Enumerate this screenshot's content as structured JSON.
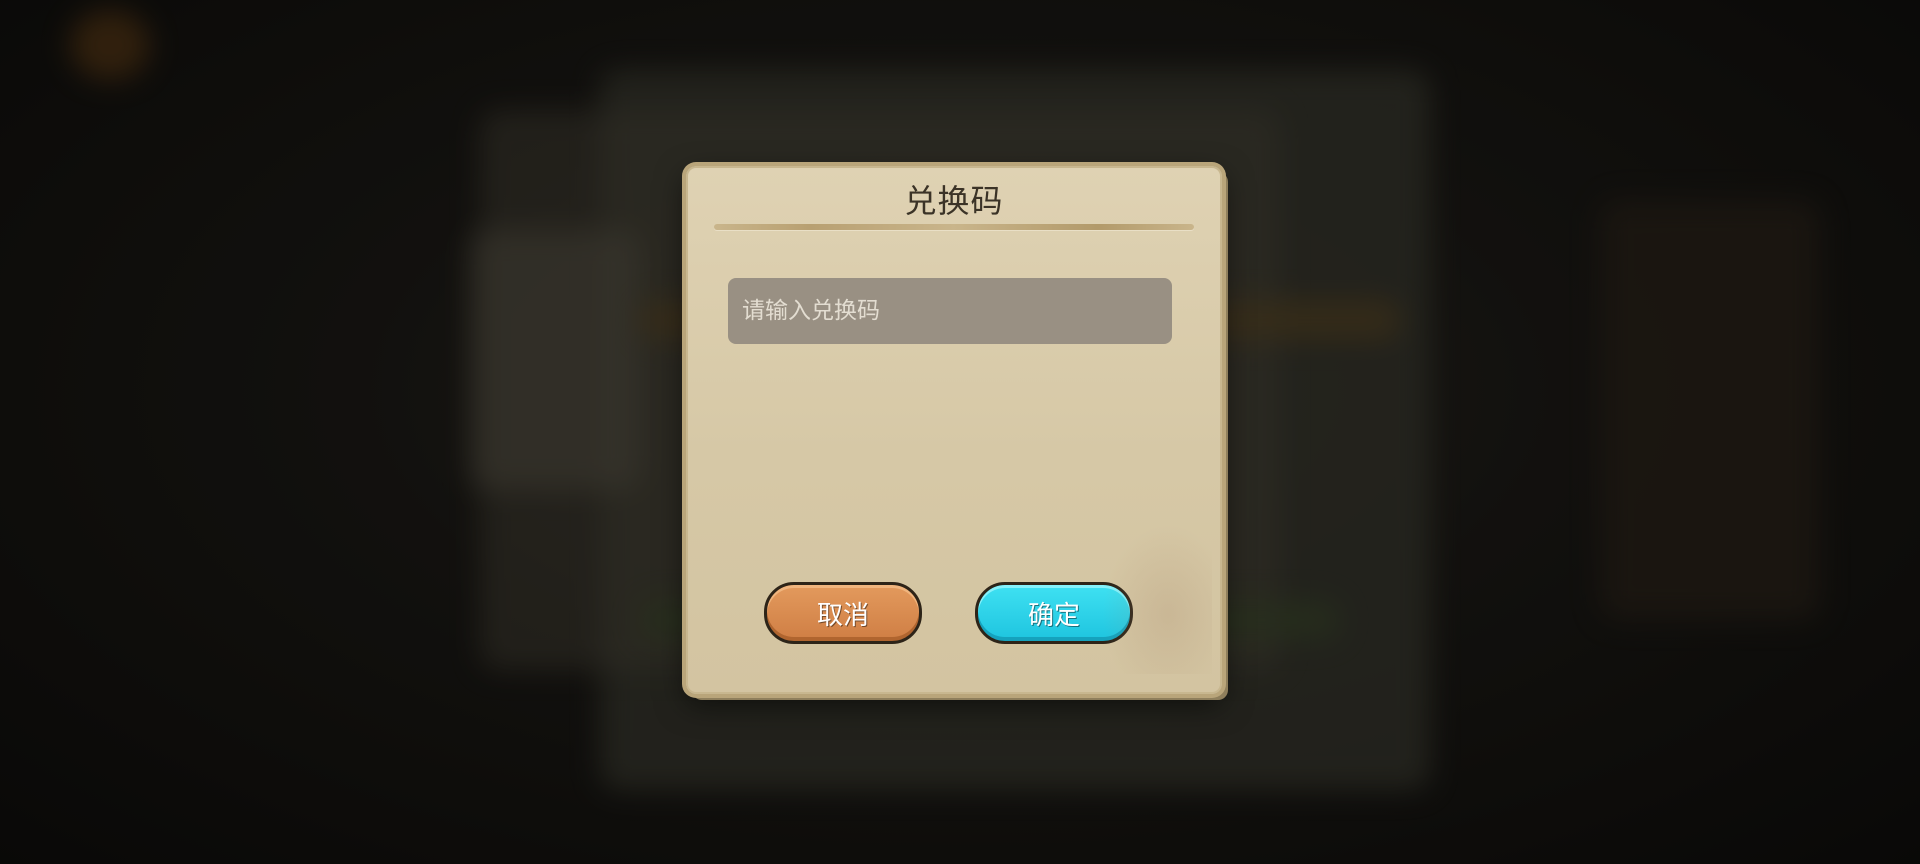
{
  "dialog": {
    "title": "兑换码",
    "input": {
      "placeholder": "请输入兑换码",
      "value": ""
    },
    "cancel_label": "取消",
    "confirm_label": "确定"
  },
  "colors": {
    "dialog_bg": "#dfd2b3",
    "input_bg": "#999083",
    "cancel_button": "#d98a4f",
    "confirm_button": "#2ad0e8",
    "title_text": "#3b3327"
  }
}
